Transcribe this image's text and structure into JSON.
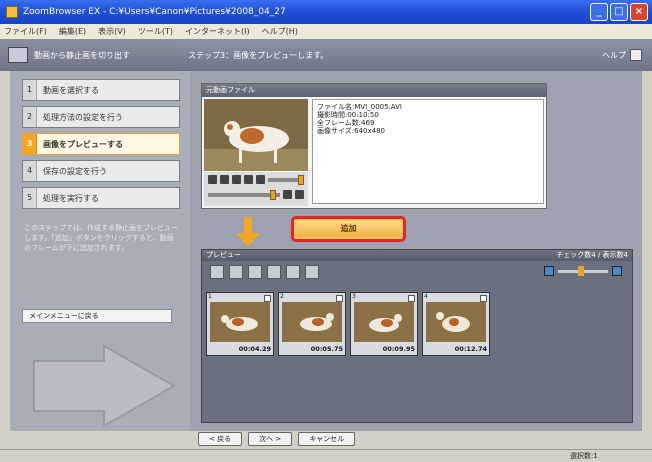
{
  "window": {
    "title": "ZoomBrowser EX - C:¥Users¥Canon¥Pictures¥2008_04_27"
  },
  "menu": [
    "ファイル(F)",
    "編集(E)",
    "表示(V)",
    "ツール(T)",
    "インターネット(I)",
    "ヘルプ(H)"
  ],
  "header": {
    "left_label": "動画から静止画を切り出す",
    "step_caption": "ステップ3：画像をプレビューします。",
    "help_label": "ヘルプ"
  },
  "steps": [
    {
      "num": "1",
      "label": "動画を選択する"
    },
    {
      "num": "2",
      "label": "処理方法の設定を行う"
    },
    {
      "num": "3",
      "label": "画像をプレビューする"
    },
    {
      "num": "4",
      "label": "保存の設定を行う"
    },
    {
      "num": "5",
      "label": "処理を実行する"
    }
  ],
  "sidebar": {
    "description": "このステップでは、作成する静止画をプレビューします。「追加」ボタンをクリックすると、動画のフレームが下に追加されます。",
    "main_menu_button": "メインメニューに戻る"
  },
  "source_panel": {
    "title": "元動画ファイル",
    "info": [
      "ファイル名:MVI_0005.AVI",
      "撮影時間:00:10:50",
      "全フレーム数:469",
      "画像サイズ:640x480"
    ]
  },
  "add_button": "追加",
  "preview_panel": {
    "title": "プレビュー",
    "right_label": "チェック数4 / 表示数4"
  },
  "thumbnails": [
    {
      "num": "1",
      "timecode": "00:04.29"
    },
    {
      "num": "2",
      "timecode": "00:05.75"
    },
    {
      "num": "3",
      "timecode": "00:09.95"
    },
    {
      "num": "4",
      "timecode": "00:12.74"
    }
  ],
  "nav": {
    "back": "< 戻る",
    "next": "次へ >",
    "cancel": "キャンセル"
  },
  "status": {
    "selection": "選択数:1"
  },
  "colors": {
    "highlight": "#e0262a",
    "accent": "#f5a623"
  }
}
